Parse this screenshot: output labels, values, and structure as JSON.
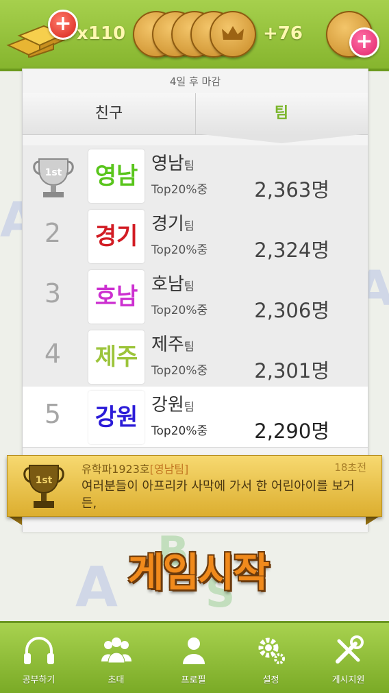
{
  "header": {
    "gold_count": "x110",
    "coin_count": "+76",
    "add_gold_icon": "plus-icon",
    "add_coin_icon": "plus-icon"
  },
  "ranking": {
    "deadline": "4일 후 마감",
    "tabs": [
      {
        "label": "친구",
        "selected": false
      },
      {
        "label": "팀",
        "selected": true
      }
    ],
    "rows": [
      {
        "rank": "1",
        "logo": "영남",
        "logo_color": "#59c51c",
        "team": "영남",
        "suffix": "팀",
        "top": "Top20%중",
        "score": "2,363명"
      },
      {
        "rank": "2",
        "logo": "경기",
        "logo_color": "#d21c24",
        "team": "경기",
        "suffix": "팀",
        "top": "Top20%중",
        "score": "2,324명"
      },
      {
        "rank": "3",
        "logo": "호남",
        "logo_color": "#cc2fd0",
        "team": "호남",
        "suffix": "팀",
        "top": "Top20%중",
        "score": "2,306명"
      },
      {
        "rank": "4",
        "logo": "제주",
        "logo_color": "#9cc43a",
        "team": "제주",
        "suffix": "팀",
        "top": "Top20%중",
        "score": "2,301명"
      },
      {
        "rank": "5",
        "logo": "강원",
        "logo_color": "#2b1bd8",
        "team": "강원",
        "suffix": "팀",
        "top": "Top20%중",
        "score": "2,290명"
      }
    ]
  },
  "notice": {
    "user": "유학파1923호",
    "team_tag": "[영남팀]",
    "time": "18초전",
    "message": "여러분들이 아프리카 사막에 가서 한 어린아이를 보거든,"
  },
  "start_button": "게임시작",
  "nav": [
    {
      "label": "공부하기",
      "icon": "headphones-icon"
    },
    {
      "label": "초대",
      "icon": "people-icon"
    },
    {
      "label": "프로필",
      "icon": "profile-icon"
    },
    {
      "label": "설정",
      "icon": "gear-icon"
    },
    {
      "label": "게시지원",
      "icon": "tools-icon"
    }
  ],
  "colors": {
    "accent_green": "#8cbc34",
    "gold": "#e6bd45",
    "start_orange": "#f08a1c"
  }
}
